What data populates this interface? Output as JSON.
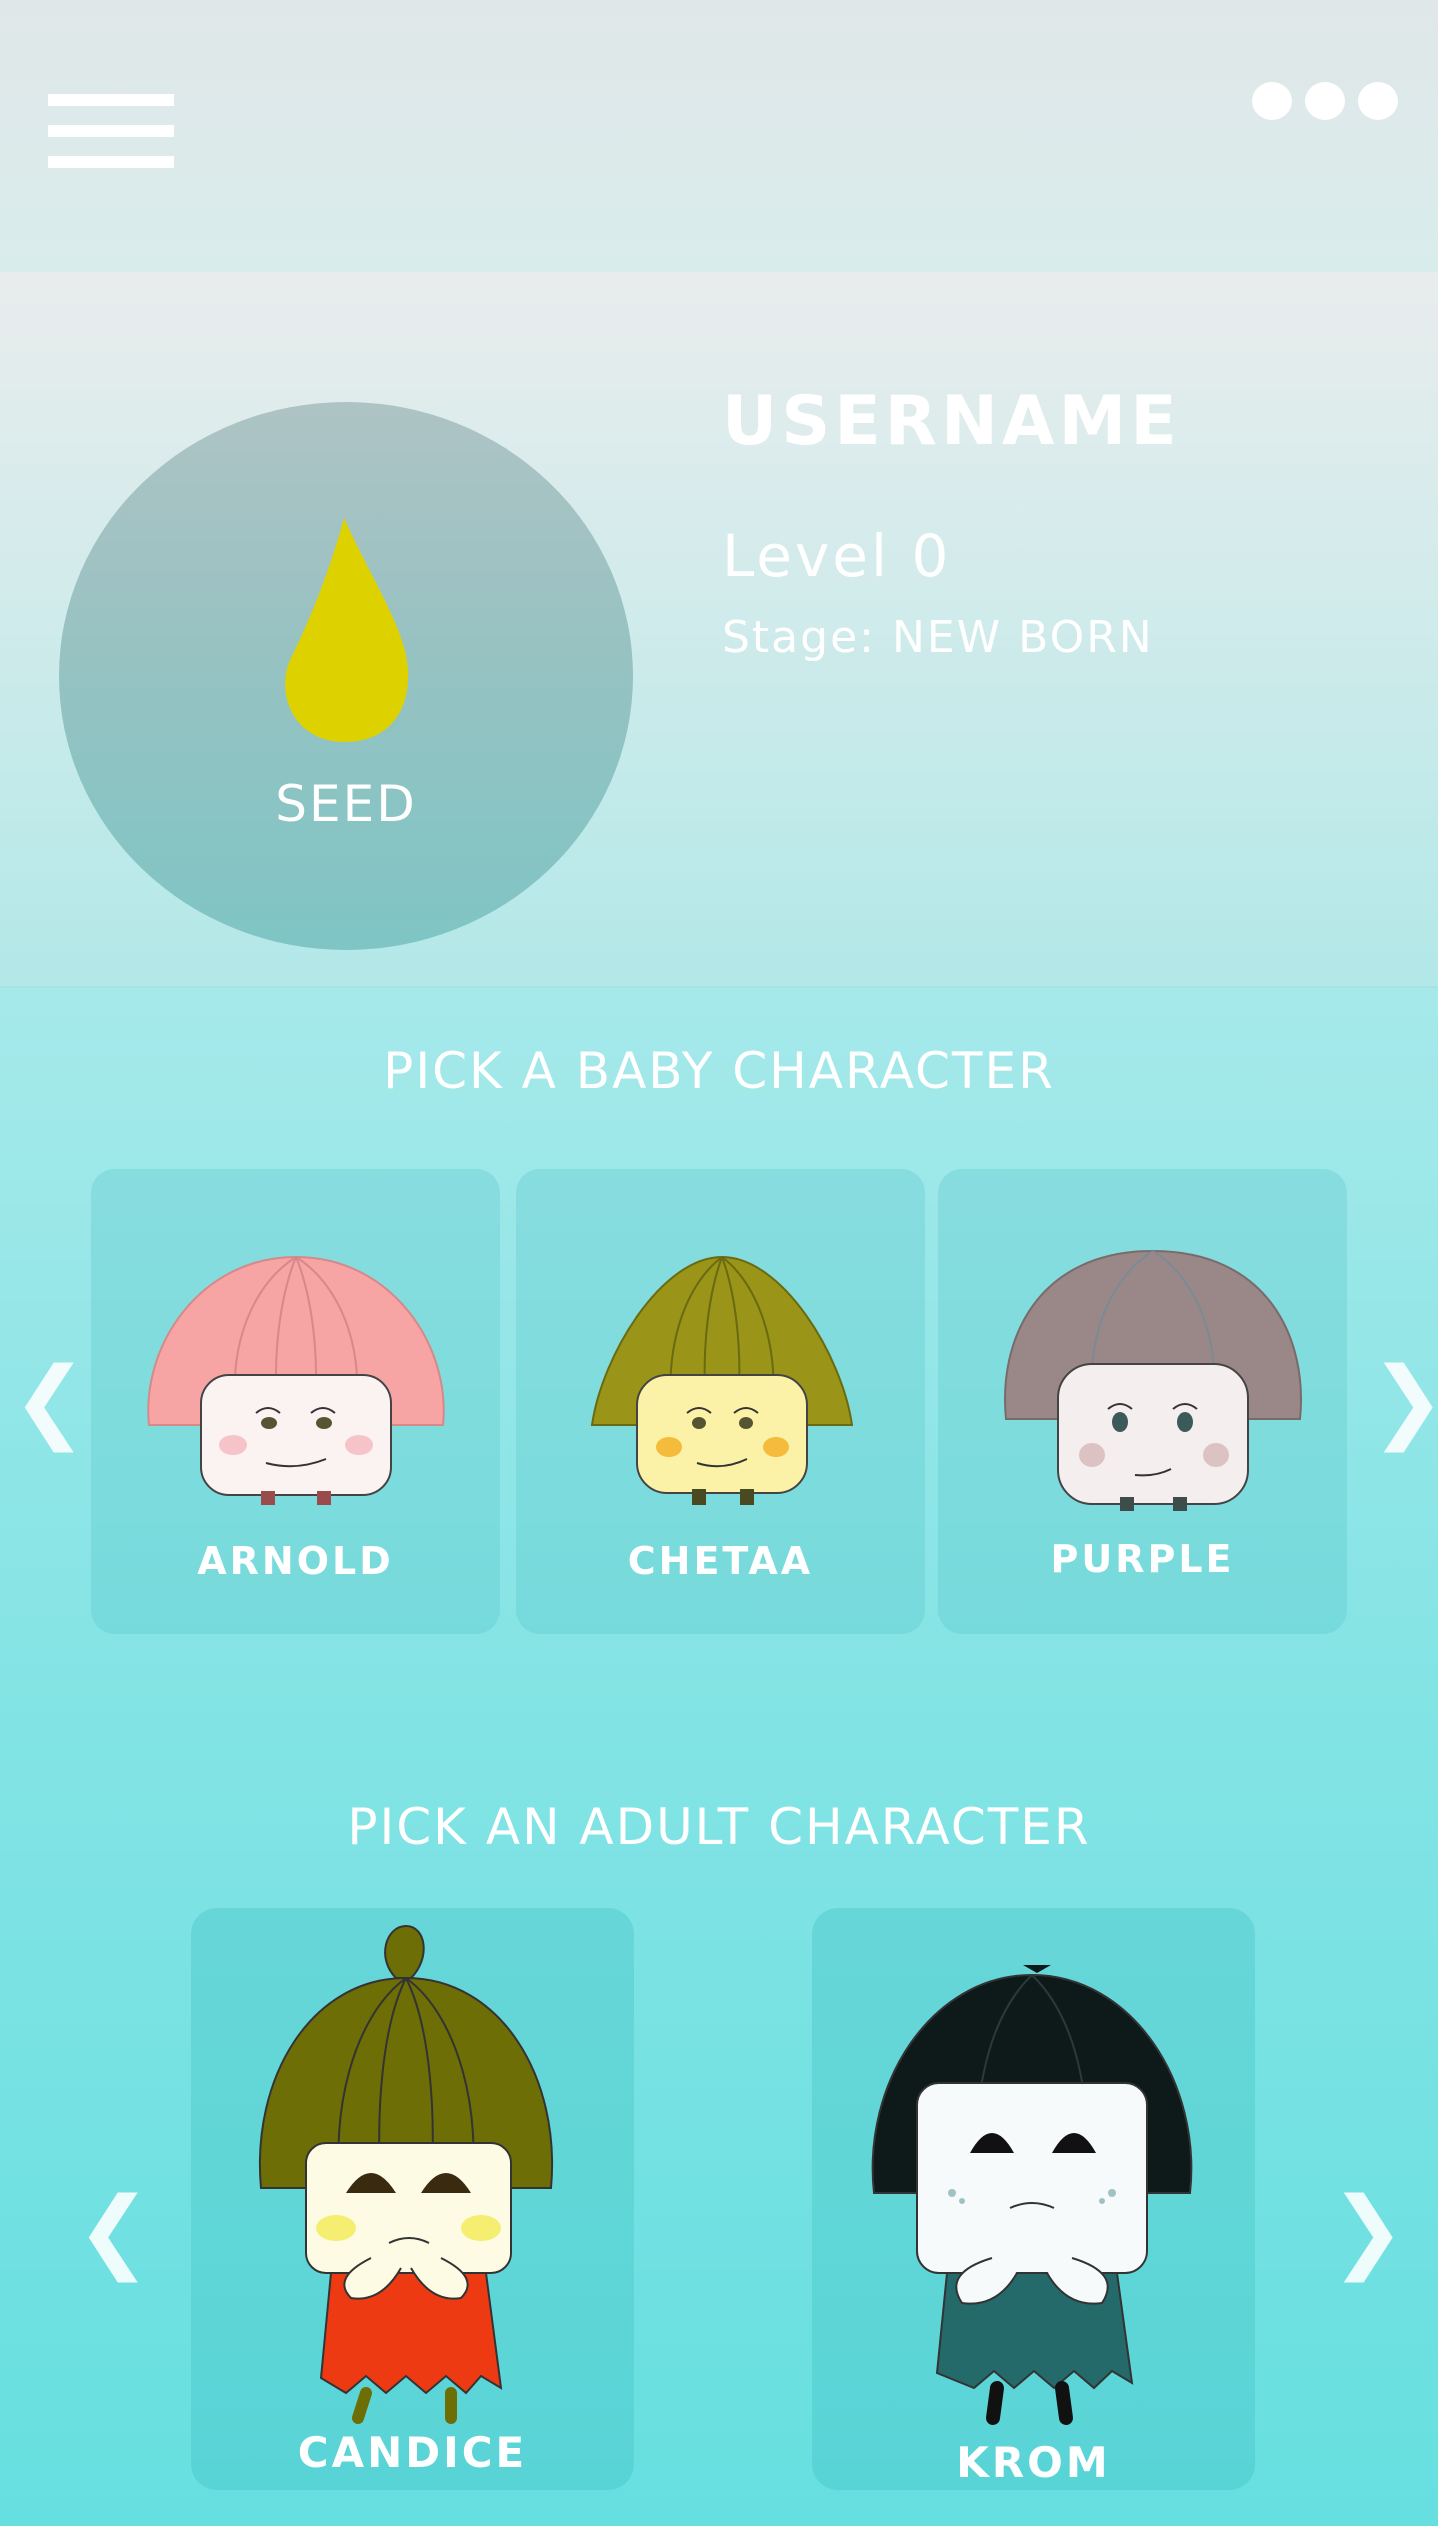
{
  "header": {
    "menu_icon": "hamburger-menu-icon",
    "more_icon": "more-dots-icon"
  },
  "profile": {
    "avatar_icon": "seed-drop-icon",
    "avatar_label": "SEED",
    "username": "USERNAME",
    "level": "Level 0",
    "stage": "Stage: NEW BORN"
  },
  "baby_section": {
    "title": "PICK A BABY CHARACTER",
    "prev_arrow": "❮",
    "next_arrow": "❯",
    "characters": [
      {
        "name": "ARNOLD",
        "hat_color": "#f7a4a4",
        "face_color": "#fbf2f2",
        "cheek_color": "#f6c3c9",
        "leg_color": "#9a4b4b"
      },
      {
        "name": "CHETAA",
        "hat_color": "#9a9518",
        "face_color": "#fcf2a7",
        "cheek_color": "#f5bb3a",
        "leg_color": "#4a4a22"
      },
      {
        "name": "PURPLE",
        "hat_color": "#9a8888",
        "face_color": "#f4eeee",
        "cheek_color": "#ddc2c3",
        "leg_color": "#3d4d4b"
      }
    ]
  },
  "adult_section": {
    "title": "PICK AN ADULT CHARACTER",
    "prev_arrow": "❮",
    "next_arrow": "❯",
    "characters": [
      {
        "name": "CANDICE",
        "hat_color": "#6e6e06",
        "face_color": "#fdfbe3",
        "dress_color": "#ee3a12"
      },
      {
        "name": "KROM",
        "hat_color": "#0e1a1a",
        "face_color": "#f6fafa",
        "dress_color": "#246a6a"
      }
    ]
  },
  "colors": {
    "seed": "#ddd200",
    "accent": "#6fe0e2"
  }
}
